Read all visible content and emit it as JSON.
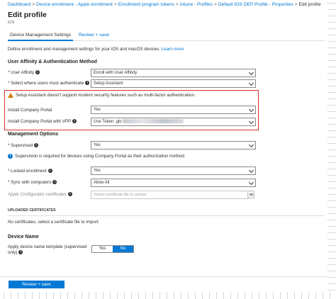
{
  "breadcrumb": {
    "items": [
      "Dashboard",
      "Device enrollment - Apple enrollment",
      "Enrollment program tokens",
      "Intune - Profiles",
      "Default IOS DEP Profile - Properties"
    ],
    "current": "Edit profile",
    "separator": ">"
  },
  "header": {
    "title": "Edit profile",
    "subtitle": "iOS"
  },
  "tabs": [
    {
      "label": "Device Management Settings",
      "active": true
    },
    {
      "label": "Review + save",
      "active": false
    }
  ],
  "description": {
    "text": "Define enrollment and management settings for your iOS and macOS devices.",
    "link": "Learn more"
  },
  "sections": {
    "auth": "User Affinity & Authentication Method",
    "management": "Management Options",
    "device_name": "Device Name"
  },
  "fields": {
    "user_affinity": {
      "label": "User Affinity",
      "value": "Enroll with User Affinity"
    },
    "auth_where": {
      "label": "Select where users must authenticate",
      "value": "Setup Assistant"
    },
    "install_cp": {
      "label": "Install Company Portal",
      "value": "Yes"
    },
    "install_cp_vpp": {
      "label": "Install Company Portal with VPP",
      "value": "Use Token: glo"
    },
    "supervised": {
      "label": "Supervised",
      "value": "Yes"
    },
    "locked_enrollment": {
      "label": "Locked enrollment",
      "value": "Yes"
    },
    "sync_computers": {
      "label": "Sync with computers",
      "value": "Allow All"
    },
    "apple_configurator_certs": {
      "label": "Apple Configurator certificates",
      "placeholder": "Select certificate file to upload"
    },
    "device_name_template": {
      "label_line1": "Apply device name template (supervised",
      "label_line2": "only)"
    }
  },
  "warning": "Setup Assistant doesn't support modern security features such as multi-factor authentication.",
  "info_note": "Supervision is required for devices using Company Portal as their authorization method.",
  "certificates": {
    "header": "UPLOADED CERTIFICATES",
    "empty": "No certificates, select a certificate file to import."
  },
  "toggle": {
    "yes": "Yes",
    "no": "No",
    "selected": "No"
  },
  "footer": {
    "primary_label": "Review + save"
  },
  "colors": {
    "accent": "#0078d4",
    "alert_border": "#d9342b",
    "warning": "#d08000"
  }
}
